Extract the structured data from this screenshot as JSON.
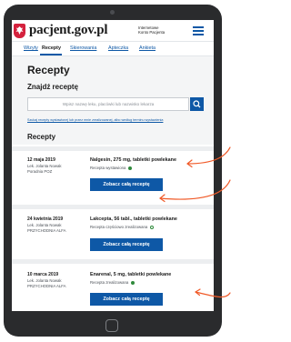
{
  "header": {
    "site_name": "pacjent.gov.pl",
    "sub_name_line1": "Internetowe",
    "sub_name_line2": "Konto Pacjenta"
  },
  "tabs": [
    {
      "label": "Wizyty"
    },
    {
      "label": "Recepty"
    },
    {
      "label": "Skierowania"
    },
    {
      "label": "Apteczka"
    },
    {
      "label": "Ankieta"
    }
  ],
  "main": {
    "title": "Recepty",
    "search": {
      "heading": "Znajdź receptę",
      "placeholder": "Wpisz nazwę leku, placówki lub nazwisko lekarza",
      "advanced_link": "Szukaj recepty wystawionej lub przez mnie zrealizowanej, albo według terminu wystawienia"
    },
    "list_title": "Recepty"
  },
  "prescriptions": [
    {
      "date": "12 maja 2019",
      "doctor": "Lek. Jolanta Nowak",
      "clinic": "Poradnia POZ",
      "drug": "Nalgesin, 275 mg, tabletki powlekane",
      "status": "Recepta wystawiona",
      "status_dot": "filled",
      "button": "Zobacz całą receptę"
    },
    {
      "date": "24 kwietnia 2019",
      "doctor": "Lek. Jolanta Nowak",
      "clinic": "PRZYCHODNIA ALFA",
      "drug": "Lakcepta, 56 tabl., tabletki powlekane",
      "status": "Recepta częściowo zrealizowana",
      "status_dot": "outline",
      "button": "Zobacz całą receptę"
    },
    {
      "date": "10 marca 2019",
      "doctor": "Lek. Jolanta Nowak",
      "clinic": "PRZYCHODNIA ALFA",
      "drug": "Enarenal, 5 mg, tabletki powlekane",
      "status": "Recepta zrealizowana",
      "status_dot": "filled",
      "button": "Zobacz całą receptę"
    }
  ],
  "colors": {
    "brand_blue": "#0e58a6",
    "emblem_red": "#d4213d",
    "status_green": "#2f8a3b",
    "annotation_orange": "#f05a28"
  },
  "icons": [
    "poland-emblem-icon",
    "menu-icon",
    "search-icon",
    "home-button-icon",
    "arrow-annotation-icon"
  ]
}
